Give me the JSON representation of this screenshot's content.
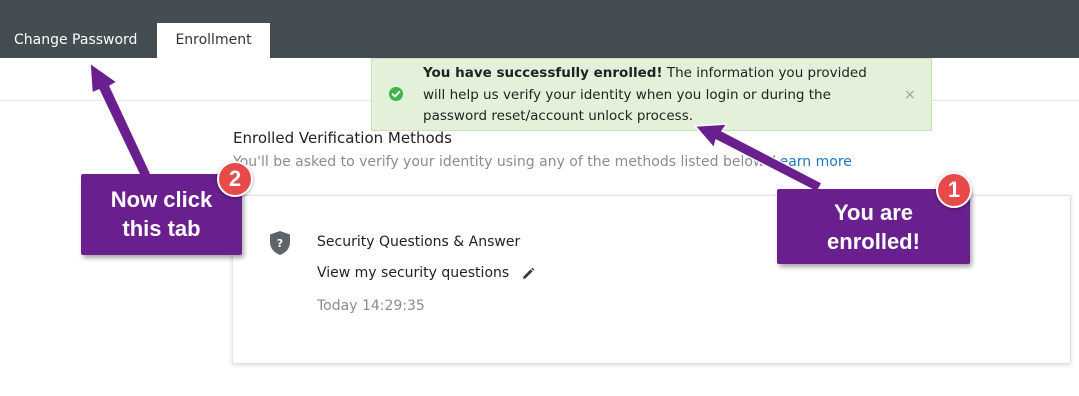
{
  "tabs": [
    {
      "label": "Change Password",
      "active": false
    },
    {
      "label": "Enrollment",
      "active": true
    }
  ],
  "toast": {
    "bold_text": "You have successfully enrolled!",
    "text": " The information you provided will help us verify your identity when you login or during the password reset/account unlock process.",
    "close_label": "×",
    "status_color": "#3fb34f"
  },
  "section": {
    "title": "Enrolled Verification Methods",
    "description": "You'll be asked to verify your identity using any of the methods listed below.",
    "learn_more": "Learn more"
  },
  "method": {
    "name": "Security Questions & Answer",
    "view_link": "View my security questions",
    "timestamp": "Today 14:29:35",
    "icon": "shield-question-icon",
    "edit_icon": "pencil-icon"
  },
  "annotations": {
    "callout_1": {
      "line1": "You are",
      "line2": "enrolled!",
      "badge": "1"
    },
    "callout_2": {
      "line1": "Now click",
      "line2": "this tab",
      "badge": "2"
    },
    "callout_color": "#6a1f8e",
    "badge_color": "#e84a4a"
  }
}
